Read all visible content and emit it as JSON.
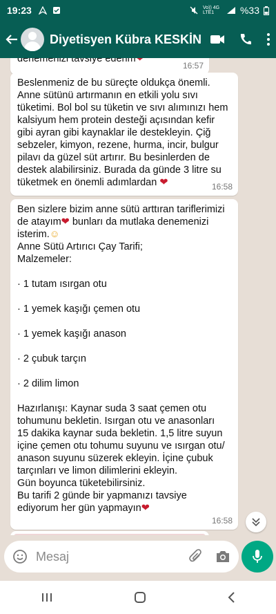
{
  "status_bar": {
    "time": "19:23",
    "network_text": "Vo)) 4G LTE1",
    "battery_text": "%33"
  },
  "header": {
    "contact_name": "Diyetisyen Kübra KESKİN",
    "icons": [
      "back-arrow-icon",
      "avatar",
      "video-call-icon",
      "phone-icon",
      "more-options-icon"
    ],
    "colors": {
      "bar": "#075e54",
      "chat_bg": "#e7ded6",
      "accent": "#00a884",
      "heart": "#c81b2e"
    }
  },
  "messages": [
    {
      "text": "denemenizi tavsiye ederim",
      "emoji": "❤",
      "time": "16:57"
    },
    {
      "text": "Beslenmeniz de bu süreçte oldukça önemli.\nAnne sütünü artırmanın en etkili yolu sıvı\ntüketimi. Bol bol su tüketin ve sıvı alımınızı hem\nkalsiyum hem protein desteği açısından kefir\ngibi ayran gibi kaynaklar ile destekleyin. Çiğ\nsebzeler, kimyon, rezene, hurma, incir, bulgur\npilavı da güzel süt artırır. Bu besinlerden de\ndestek alabilirsiniz. Burada da günde 3 litre su\ntüketmek en önemli adımlardan",
      "emoji": "❤",
      "time": "16:58"
    },
    {
      "intro_part1": "Ben sizlere bizim anne sütü arttıran tariflerimizi\nde atayım",
      "intro_heart": "❤",
      "intro_part2": " bunları da mutlaka denemenizi\nisterim.",
      "intro_smile": "☺",
      "body": "\nAnne Sütü Artırıcı Çay Tarifi;\nMalzemeler:\n\n· 1 tutam ısırgan otu\n\n· 1 yemek kaşığı çemen otu\n\n· 1 yemek kaşığı anason\n\n· 2 çubuk tarçın\n\n· 2 dilim limon\n\nHazırlanışı: Kaynar suda 3 saat çemen otu\ntohumunu bekletin. Isırgan otu ve anasonları\n15 dakika kaynar suda bekletin. 1,5 litre suyun\niçine çemen otu tohumu suyunu ve ısırgan otu/\nanason suyunu süzerek ekleyin. İçine çubuk\ntarçınları ve limon dilimlerini ekleyin.\nGün boyunca tüketebilirsiniz.\nBu tarifi 2 günde bir yapmanızı tavsiye\nediyorum her gün yapmayın",
      "emoji": "❤",
      "time": "16:58"
    }
  ],
  "input": {
    "placeholder": "Mesaj"
  }
}
